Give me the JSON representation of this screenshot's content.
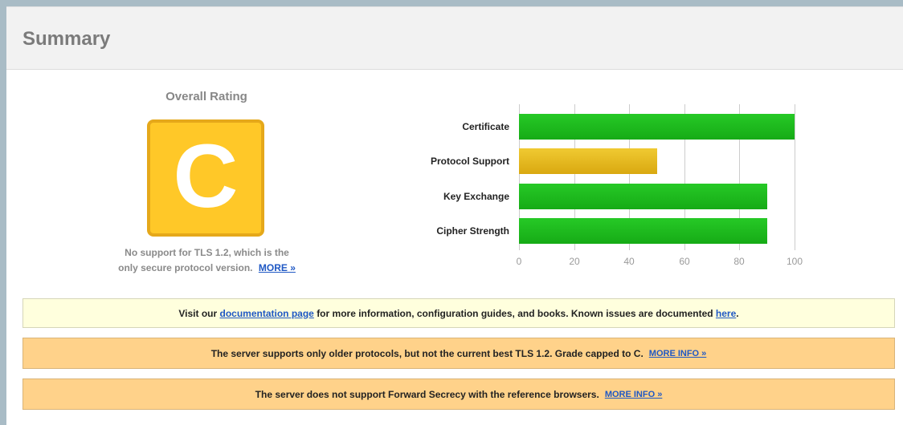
{
  "header": {
    "title": "Summary"
  },
  "rating": {
    "title": "Overall Rating",
    "grade": "C",
    "note_line1": "No support for TLS 1.2, which is the",
    "note_line2": "only secure protocol version.",
    "more_link": "MORE »"
  },
  "chart_data": {
    "type": "bar",
    "orientation": "horizontal",
    "categories": [
      "Certificate",
      "Protocol Support",
      "Key Exchange",
      "Cipher Strength"
    ],
    "values": [
      100,
      50,
      90,
      90
    ],
    "xlim": [
      0,
      100
    ],
    "ticks": [
      0,
      20,
      40,
      60,
      80,
      100
    ],
    "grid": true,
    "colors": [
      "#1fbd1f",
      "#e8bb1e",
      "#1fbd1f",
      "#1fbd1f"
    ]
  },
  "banners": {
    "info": {
      "prefix": "Visit our ",
      "link1": "documentation page",
      "middle": " for more information, configuration guides, and books. Known issues are documented ",
      "link2": "here",
      "suffix": "."
    },
    "warn1": {
      "text": "The server supports only older protocols, but not the current best TLS 1.2. Grade capped to C.",
      "link": "MORE INFO »"
    },
    "warn2": {
      "text": "The server does not support Forward Secrecy with the reference browsers.",
      "link": "MORE INFO »"
    }
  }
}
